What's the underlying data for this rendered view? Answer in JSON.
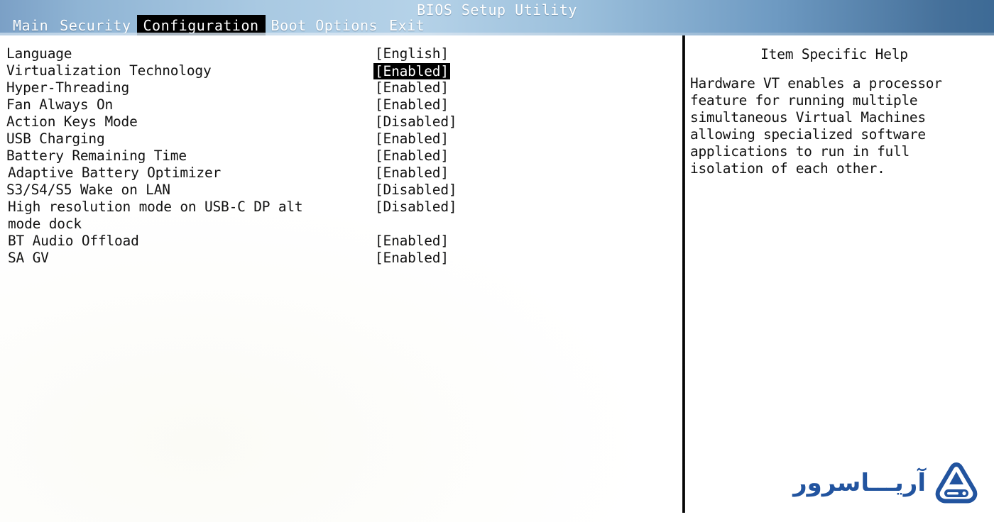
{
  "header": {
    "title": "BIOS Setup Utility",
    "menu": [
      {
        "label": "Main",
        "selected": false
      },
      {
        "label": "Security",
        "selected": false
      },
      {
        "label": "Configuration",
        "selected": true
      },
      {
        "label": "Boot Options",
        "selected": false
      },
      {
        "label": "Exit",
        "selected": false
      }
    ]
  },
  "settings": [
    {
      "label": "Language",
      "value": "[English]",
      "selected": false,
      "indent": false
    },
    {
      "label": "Virtualization Technology",
      "value": "[Enabled]",
      "selected": true,
      "indent": false
    },
    {
      "label": "Hyper-Threading",
      "value": "[Enabled]",
      "selected": false,
      "indent": false
    },
    {
      "label": "Fan Always On",
      "value": "[Enabled]",
      "selected": false,
      "indent": false
    },
    {
      "label": "Action Keys Mode",
      "value": "[Disabled]",
      "selected": false,
      "indent": false
    },
    {
      "label": "USB Charging",
      "value": "[Enabled]",
      "selected": false,
      "indent": false
    },
    {
      "label": "Battery Remaining Time",
      "value": "[Enabled]",
      "selected": false,
      "indent": false
    },
    {
      "label": "Adaptive Battery Optimizer",
      "value": "[Enabled]",
      "selected": false,
      "indent": true
    },
    {
      "label": "S3/S4/S5 Wake on LAN",
      "value": "[Disabled]",
      "selected": false,
      "indent": false
    },
    {
      "label": "High resolution mode on USB-C DP alt",
      "value": "[Disabled]",
      "selected": false,
      "indent": true
    },
    {
      "label": "mode dock",
      "value": "",
      "selected": false,
      "indent": true
    },
    {
      "label": "BT Audio Offload",
      "value": "[Enabled]",
      "selected": false,
      "indent": true
    },
    {
      "label": "SA GV",
      "value": "[Enabled]",
      "selected": false,
      "indent": true
    }
  ],
  "help": {
    "title": "Item Specific Help",
    "body": "Hardware VT enables a processor\nfeature for running multiple\nsimultaneous Virtual Machines\nallowing specialized software\napplications to run in full\nisolation of each other."
  },
  "watermark": {
    "text": "آریـــاسرور",
    "icon": "server-drive-logo-icon",
    "color": "#1b4f9c"
  },
  "colors": {
    "header_left": "#7ba0c6",
    "header_mid": "#b5d2e8",
    "header_right": "#3d6a95",
    "selection_bg": "#000000",
    "selection_fg": "#ffffff",
    "text": "#121212",
    "background": "#fdfdfc"
  }
}
